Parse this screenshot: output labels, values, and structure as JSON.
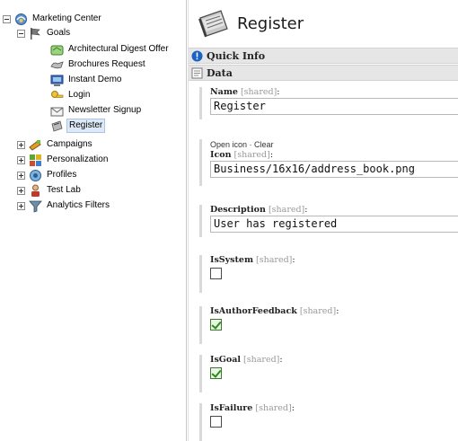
{
  "tree": {
    "root": {
      "label": "Marketing Center",
      "icon": "marketing-center-icon"
    },
    "goals": {
      "label": "Goals",
      "icon": "goals-flag-icon"
    },
    "goal_items": [
      {
        "label": "Architectural Digest Offer",
        "icon": "offer-icon"
      },
      {
        "label": "Brochures Request",
        "icon": "brochures-icon"
      },
      {
        "label": "Instant Demo",
        "icon": "instant-demo-icon"
      },
      {
        "label": "Login",
        "icon": "login-key-icon"
      },
      {
        "label": "Newsletter Signup",
        "icon": "newsletter-icon"
      },
      {
        "label": "Register",
        "icon": "register-icon",
        "selected": true
      }
    ],
    "sections": [
      {
        "label": "Campaigns",
        "icon": "campaigns-icon"
      },
      {
        "label": "Personalization",
        "icon": "personalization-icon"
      },
      {
        "label": "Profiles",
        "icon": "profiles-icon"
      },
      {
        "label": "Test Lab",
        "icon": "test-lab-icon"
      },
      {
        "label": "Analytics Filters",
        "icon": "analytics-filter-icon"
      }
    ]
  },
  "editor": {
    "title": "Register",
    "quick_info": "Quick Info",
    "data_section": "Data",
    "shared_tag": "[shared]",
    "fields": {
      "name": {
        "label": "Name",
        "value": "Register"
      },
      "icon": {
        "links": "Open icon · Clear",
        "label": "Icon",
        "value": "Business/16x16/address_book.png"
      },
      "description": {
        "label": "Description",
        "value": "User has registered"
      },
      "is_system": {
        "label": "IsSystem",
        "checked": false
      },
      "is_author_feedback": {
        "label": "IsAuthorFeedback",
        "checked": true
      },
      "is_goal": {
        "label": "IsGoal",
        "checked": true
      },
      "is_failure": {
        "label": "IsFailure",
        "checked": false
      }
    }
  },
  "colors": {
    "selection": "#dde9f7",
    "section_bar": "#e6e6e6",
    "quick_info_accent": "#1c62c4",
    "checkmark": "#2c8a1d"
  }
}
